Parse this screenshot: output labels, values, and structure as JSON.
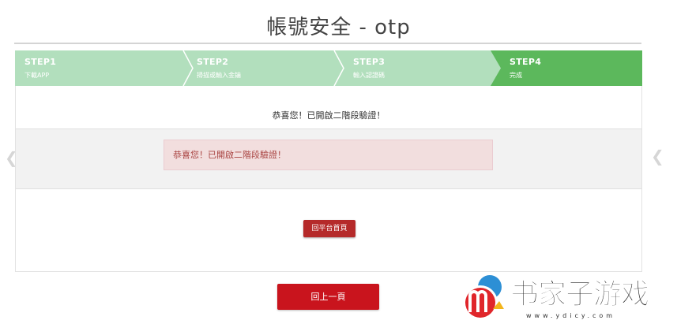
{
  "page": {
    "title": "帳號安全 - otp"
  },
  "steps": [
    {
      "num": "STEP1",
      "label": "下載APP"
    },
    {
      "num": "STEP2",
      "label": "掃描或輸入金鑰"
    },
    {
      "num": "STEP3",
      "label": "輸入認證碼"
    },
    {
      "num": "STEP4",
      "label": "完成"
    }
  ],
  "content": {
    "message": "恭喜您！已開啟二階段驗證！",
    "alert": "恭喜您！已開啟二階段驗證！",
    "home_button": "回平台首頁"
  },
  "footer": {
    "back_button": "回上一頁"
  },
  "carousel": {
    "prev": "❮",
    "next": "❮"
  },
  "watermark": {
    "text": "书家子游戏",
    "url": "www.ydicy.com"
  },
  "colors": {
    "step_done": "#5cb85c",
    "step_pending": "#b2dfbd",
    "alert_bg": "#f2dede",
    "button": "#c9141d"
  }
}
